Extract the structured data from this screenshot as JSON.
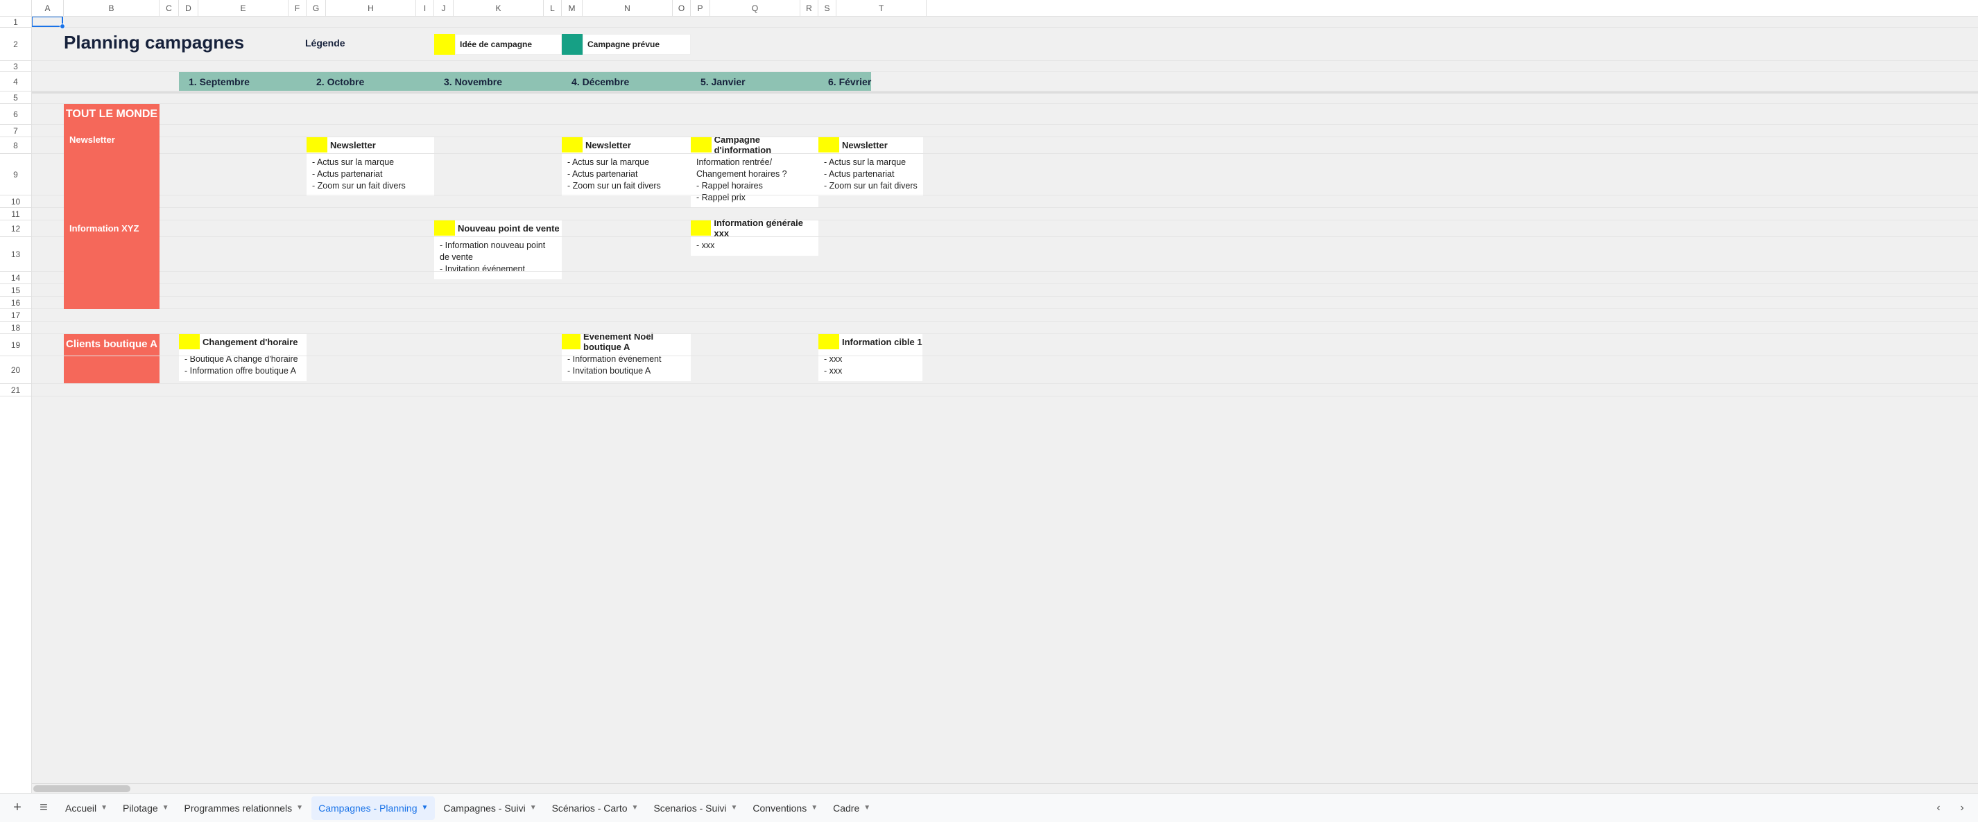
{
  "columns": [
    {
      "label": "A",
      "w": 46
    },
    {
      "label": "B",
      "w": 138
    },
    {
      "label": "C",
      "w": 28
    },
    {
      "label": "D",
      "w": 28
    },
    {
      "label": "E",
      "w": 130
    },
    {
      "label": "F",
      "w": 26
    },
    {
      "label": "G",
      "w": 28
    },
    {
      "label": "H",
      "w": 130
    },
    {
      "label": "I",
      "w": 26
    },
    {
      "label": "J",
      "w": 28
    },
    {
      "label": "K",
      "w": 130
    },
    {
      "label": "L",
      "w": 26
    },
    {
      "label": "M",
      "w": 30
    },
    {
      "label": "N",
      "w": 130
    },
    {
      "label": "O",
      "w": 26
    },
    {
      "label": "P",
      "w": 28
    },
    {
      "label": "Q",
      "w": 130
    },
    {
      "label": "R",
      "w": 26
    },
    {
      "label": "S",
      "w": 26
    },
    {
      "label": "T",
      "w": 130
    }
  ],
  "rows": [
    {
      "n": 1,
      "h": 16
    },
    {
      "n": 2,
      "h": 48
    },
    {
      "n": 3,
      "h": 16
    },
    {
      "n": 4,
      "h": 28
    },
    {
      "n": 5,
      "h": 18
    },
    {
      "n": 6,
      "h": 30
    },
    {
      "n": 7,
      "h": 18
    },
    {
      "n": 8,
      "h": 24
    },
    {
      "n": 9,
      "h": 60
    },
    {
      "n": 10,
      "h": 18
    },
    {
      "n": 11,
      "h": 18
    },
    {
      "n": 12,
      "h": 24
    },
    {
      "n": 13,
      "h": 50
    },
    {
      "n": 14,
      "h": 18
    },
    {
      "n": 15,
      "h": 18
    },
    {
      "n": 16,
      "h": 18
    },
    {
      "n": 17,
      "h": 18
    },
    {
      "n": 18,
      "h": 18
    },
    {
      "n": 19,
      "h": 32
    },
    {
      "n": 20,
      "h": 40
    },
    {
      "n": 21,
      "h": 18
    }
  ],
  "title": "Planning campagnes",
  "legend": {
    "label": "Légende",
    "idea": "Idée de campagne",
    "planned": "Campagne prévue"
  },
  "months": [
    "1.   Septembre",
    "2.   Octobre",
    "3.   Novembre",
    "4.   Décembre",
    "5.   Janvier",
    "6.   Février"
  ],
  "red1": {
    "title": "TOUT LE MONDE",
    "r1": "Newsletter",
    "r2": "Information XYZ"
  },
  "red2": {
    "title": "Clients boutique A"
  },
  "cards": {
    "news_oct": {
      "title": "Newsletter",
      "body": "- Actus sur la marque\n- Actus partenariat\n- Zoom sur un fait divers"
    },
    "news_dec": {
      "title": "Newsletter",
      "body": "- Actus sur la marque\n- Actus partenariat\n- Zoom sur un fait divers"
    },
    "camp_jan": {
      "title": "Campagne d'information",
      "body": "Information rentrée/\nChangement horaires ?\n  - Rappel horaires\n  - Rappel prix"
    },
    "news_fev": {
      "title": "Newsletter",
      "body": "- Actus sur la marque\n- Actus partenariat\n- Zoom sur un fait divers"
    },
    "pdv_nov": {
      "title": "Nouveau point de vente",
      "body": "- Information nouveau point de vente\n- Invitation événement"
    },
    "info_jan": {
      "title": "Information générale xxx",
      "body": "- xxx"
    },
    "horaire": {
      "title": "Changement d'horaire",
      "body": "- Boutique A change d'horaire\n- Information offre boutique A"
    },
    "noel": {
      "title": "Evenement Noël boutique A",
      "body": "- Information événement\n- Invitation boutique A"
    },
    "cible1": {
      "title": "Information cible 1",
      "body": "- xxx\n- xxx"
    }
  },
  "tabs": [
    "Accueil",
    "Pilotage",
    "Programmes relationnels",
    "Campagnes - Planning",
    "Campagnes - Suivi",
    "Scénarios - Carto",
    "Scenarios - Suivi",
    "Conventions",
    "Cadre"
  ],
  "active_tab_index": 3
}
